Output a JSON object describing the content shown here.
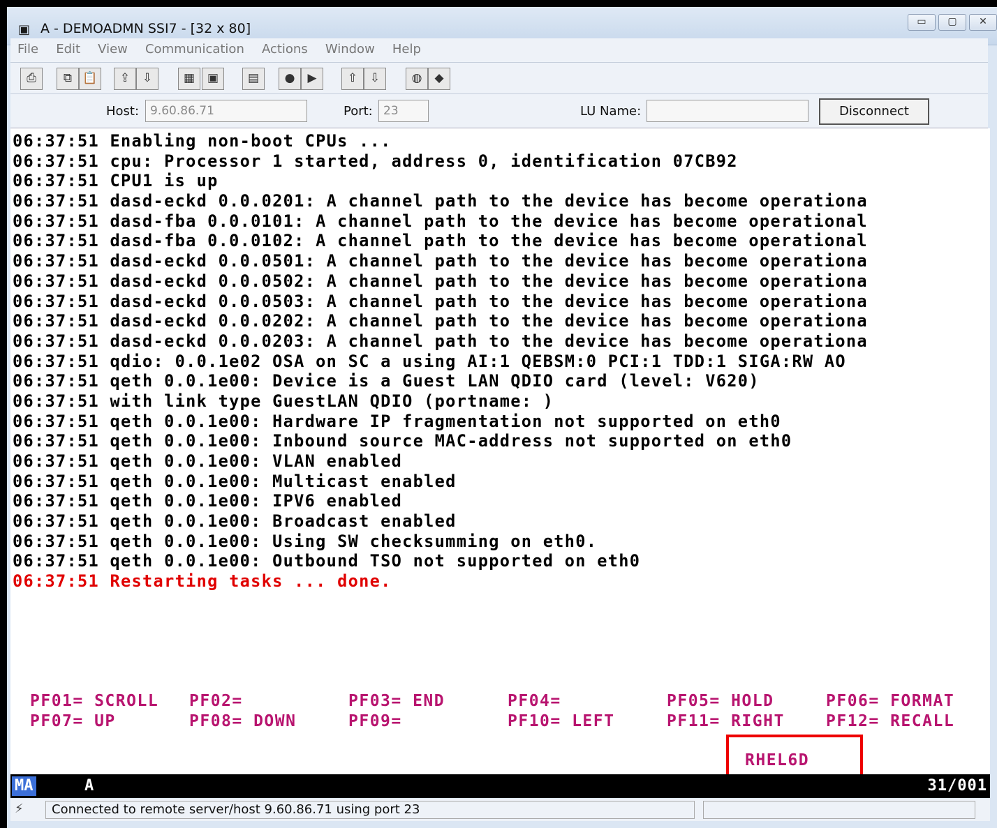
{
  "window": {
    "title": "A - DEMOADMN SSI7 - [32 x 80]",
    "controls": [
      "▭",
      "▢",
      "✕"
    ]
  },
  "menu": [
    "File",
    "Edit",
    "View",
    "Communication",
    "Actions",
    "Window",
    "Help"
  ],
  "toolbar": {
    "icons": [
      "print-screen-icon",
      "copy-icon",
      "paste-icon",
      "send-icon",
      "receive-icon",
      "display-icon",
      "keypad-icon",
      "macro-icon",
      "record-macro-icon",
      "play-macro-icon",
      "transfer-up-icon",
      "transfer-down-icon",
      "globe-icon",
      "help-icon"
    ]
  },
  "connection": {
    "host_label": "Host:",
    "host_value": "9.60.86.71",
    "port_label": "Port:",
    "port_value": "23",
    "lu_label": "LU Name:",
    "lu_value": "",
    "disconnect_label": "Disconnect"
  },
  "terminal": {
    "lines": [
      {
        "text": "06:37:51 Enabling non-boot CPUs ...",
        "color": "black"
      },
      {
        "text": "06:37:51 cpu: Processor 1 started, address 0, identification 07CB92",
        "color": "black"
      },
      {
        "text": "06:37:51 CPU1 is up",
        "color": "black"
      },
      {
        "text": "06:37:51 dasd-eckd 0.0.0201: A channel path to the device has become operationa",
        "color": "black"
      },
      {
        "text": "06:37:51 dasd-fba 0.0.0101: A channel path to the device has become operational",
        "color": "black"
      },
      {
        "text": "06:37:51 dasd-fba 0.0.0102: A channel path to the device has become operational",
        "color": "black"
      },
      {
        "text": "06:37:51 dasd-eckd 0.0.0501: A channel path to the device has become operationa",
        "color": "black"
      },
      {
        "text": "06:37:51 dasd-eckd 0.0.0502: A channel path to the device has become operationa",
        "color": "black"
      },
      {
        "text": "06:37:51 dasd-eckd 0.0.0503: A channel path to the device has become operationa",
        "color": "black"
      },
      {
        "text": "06:37:51 dasd-eckd 0.0.0202: A channel path to the device has become operationa",
        "color": "black"
      },
      {
        "text": "06:37:51 dasd-eckd 0.0.0203: A channel path to the device has become operationa",
        "color": "black"
      },
      {
        "text": "06:37:51 qdio: 0.0.1e02 OSA on SC a using AI:1 QEBSM:0 PCI:1 TDD:1 SIGA:RW AO",
        "color": "black"
      },
      {
        "text": "06:37:51 qeth 0.0.1e00: Device is a Guest LAN QDIO card (level: V620)",
        "color": "black"
      },
      {
        "text": "06:37:51 with link type GuestLAN QDIO (portname: )",
        "color": "black"
      },
      {
        "text": "06:37:51 qeth 0.0.1e00: Hardware IP fragmentation not supported on eth0",
        "color": "black"
      },
      {
        "text": "06:37:51 qeth 0.0.1e00: Inbound source MAC-address not supported on eth0",
        "color": "black"
      },
      {
        "text": "06:37:51 qeth 0.0.1e00: VLAN enabled",
        "color": "black"
      },
      {
        "text": "06:37:51 qeth 0.0.1e00: Multicast enabled",
        "color": "black"
      },
      {
        "text": "06:37:51 qeth 0.0.1e00: IPV6 enabled",
        "color": "black"
      },
      {
        "text": "06:37:51 qeth 0.0.1e00: Broadcast enabled",
        "color": "black"
      },
      {
        "text": "06:37:51 qeth 0.0.1e00: Using SW checksumming on eth0.",
        "color": "black"
      },
      {
        "text": "06:37:51 qeth 0.0.1e00: Outbound TSO not supported on eth0",
        "color": "black"
      },
      {
        "text": "06:37:51 Restarting tasks ... done.",
        "color": "#e00000"
      }
    ],
    "pf_row1": [
      "PF01= SCROLL",
      "PF02=",
      "PF03= END",
      "PF04=",
      "PF05= HOLD",
      "PF06= FORMAT"
    ],
    "pf_row2": [
      "PF07= UP",
      "PF08= DOWN",
      "PF09=",
      "PF10= LEFT",
      "PF11= RIGHT",
      "PF12= RECALL"
    ],
    "system_name": "RHEL6D",
    "pf_color": "#b8146f"
  },
  "oia": {
    "mode": "MA",
    "session": "A",
    "cursor_pos": "31/001"
  },
  "status": {
    "message": "Connected to remote server/host 9.60.86.71 using port 23"
  }
}
